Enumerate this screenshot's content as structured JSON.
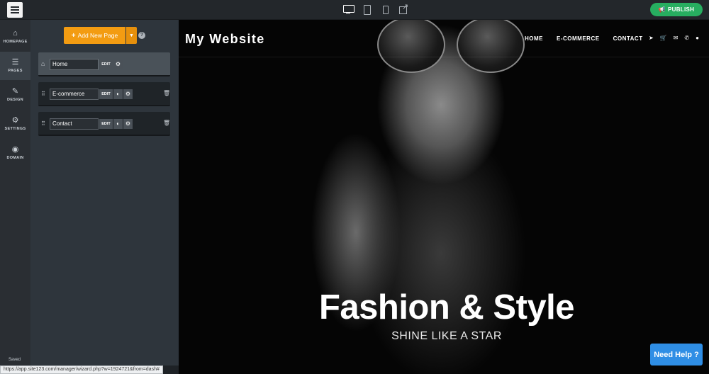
{
  "topbar": {
    "device_icons": [
      "desktop-icon",
      "tablet-icon",
      "mobile-icon",
      "external-link-icon"
    ],
    "publish_label": "PUBLISH",
    "publish_color": "#27ae60"
  },
  "leftnav": {
    "items": [
      {
        "label": "HOMEPAGE",
        "icon": "home-icon"
      },
      {
        "label": "PAGES",
        "icon": "pages-icon"
      },
      {
        "label": "DESIGN",
        "icon": "brush-icon"
      },
      {
        "label": "SETTINGS",
        "icon": "gear-icon"
      },
      {
        "label": "DOMAIN",
        "icon": "globe-icon"
      }
    ],
    "active": "PAGES",
    "saved_label": "Saved"
  },
  "pages_panel": {
    "add_page_label": "Add New Page",
    "add_page_color": "#f39c12",
    "rows": [
      {
        "name": "Home",
        "edit_label": "EDIT",
        "icons": [
          "gear-icon"
        ],
        "deletable": false
      },
      {
        "name": "E-commerce",
        "edit_label": "EDIT",
        "icons": [
          "palette-icon",
          "gear-icon"
        ],
        "deletable": true
      },
      {
        "name": "Contact",
        "edit_label": "EDIT",
        "icons": [
          "palette-icon",
          "gear-icon"
        ],
        "deletable": true
      }
    ]
  },
  "site": {
    "title": "My Website",
    "nav": [
      "HOME",
      "E-COMMERCE",
      "CONTACT"
    ],
    "nav_icons": [
      "send-icon",
      "cart-icon",
      "envelope-icon",
      "phone-icon",
      "user-icon"
    ],
    "hero_title": "Fashion & Style",
    "hero_subtitle": "SHINE LIKE A STAR",
    "help_label": "Need Help ?",
    "help_color": "#2f8ee5"
  },
  "status_url": "https://app.site123.com/manager/wizard.php?w=1924721&from=dash#"
}
